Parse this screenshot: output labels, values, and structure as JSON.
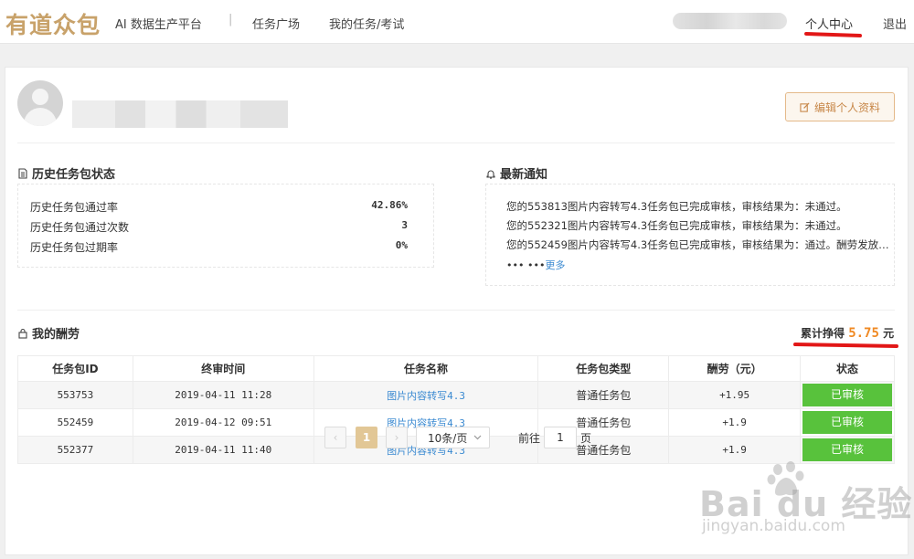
{
  "header": {
    "logo": "有道众包",
    "platform": "AI 数据生产平台",
    "separator": "|",
    "nav": [
      "任务广场",
      "我的任务/考试"
    ],
    "personal_center": "个人中心",
    "logout": "退出"
  },
  "profile": {
    "edit_button": "编辑个人资料"
  },
  "history": {
    "title": "历史任务包状态",
    "rows": [
      {
        "label": "历史任务包通过率",
        "value": "42.86%"
      },
      {
        "label": "历史任务包通过次数",
        "value": "3"
      },
      {
        "label": "历史任务包过期率",
        "value": "0%"
      }
    ]
  },
  "notices": {
    "title": "最新通知",
    "items": [
      "您的553813图片内容转写4.3任务包已完成审核，审核结果为：未通过。",
      "您的552321图片内容转写4.3任务包已完成审核，审核结果为：未通过。",
      "您的552459图片内容转写4.3任务包已完成审核，审核结果为：通过。酬劳发放…"
    ],
    "ellipsis": "••• •••",
    "more": "更多"
  },
  "earnings": {
    "title": "我的酬劳",
    "total_label": "累计挣得",
    "total_value": "5.75",
    "unit": "元"
  },
  "table": {
    "headers": [
      "任务包ID",
      "终审时间",
      "任务名称",
      "任务包类型",
      "酬劳（元）",
      "状态"
    ],
    "rows": [
      [
        "553753",
        "2019-04-11 11:28",
        "图片内容转写4.3",
        "普通任务包",
        "+1.95",
        "已审核"
      ],
      [
        "552459",
        "2019-04-12 09:51",
        "图片内容转写4.3",
        "普通任务包",
        "+1.9",
        "已审核"
      ],
      [
        "552377",
        "2019-04-11 11:40",
        "图片内容转写4.3",
        "普通任务包",
        "+1.9",
        "已审核"
      ]
    ]
  },
  "pagination": {
    "prev": "‹",
    "page": "1",
    "next": "›",
    "page_size": "10条/页",
    "goto_label": "前往",
    "goto_value": "1",
    "goto_unit": "页"
  },
  "watermark": {
    "brand": "Bai du 经验",
    "url": "jingyan.baidu.com"
  },
  "colors": {
    "brand_gold": "#c8a26a",
    "status_green": "#58c23c",
    "link_blue": "#3b8ad1",
    "earn_orange": "#f08a24",
    "annotation_red": "#e21717"
  },
  "icons": {
    "edit": "edit-icon",
    "history": "document-icon",
    "notice": "bell-icon",
    "earnings": "lock-icon",
    "page_size": "chevron-down-icon"
  }
}
